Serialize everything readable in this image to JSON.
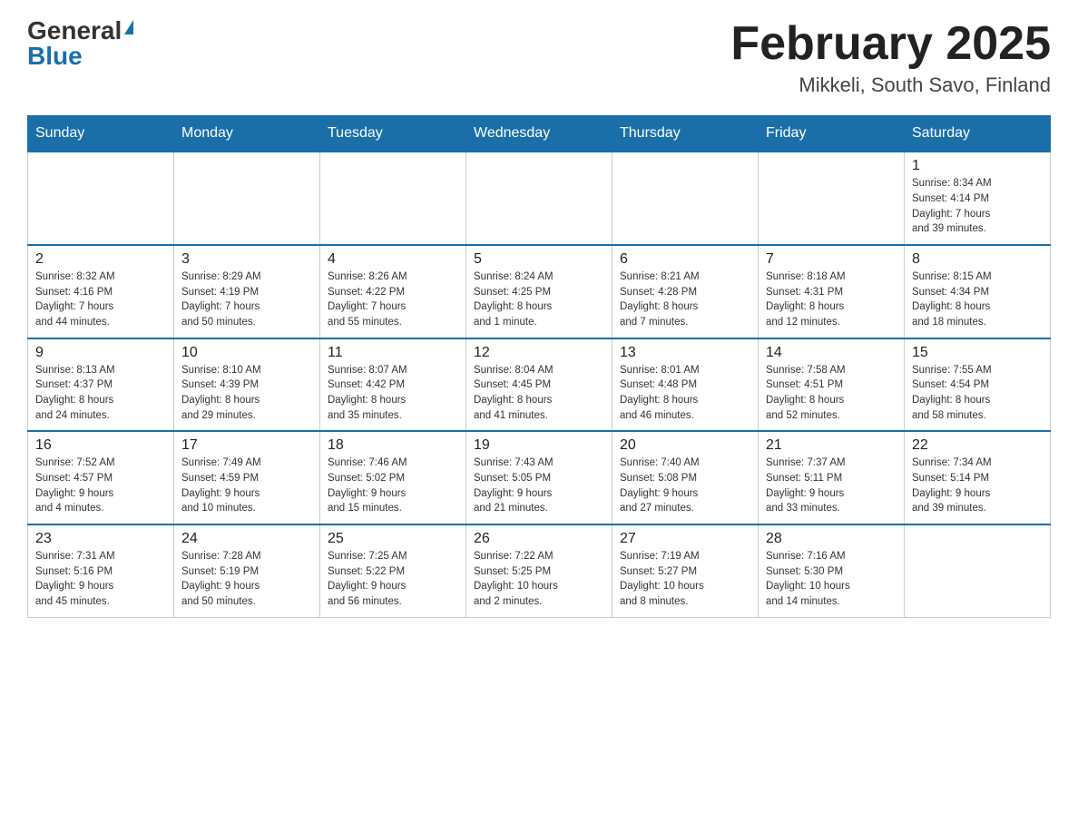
{
  "header": {
    "logo_general": "General",
    "logo_blue": "Blue",
    "title": "February 2025",
    "subtitle": "Mikkeli, South Savo, Finland"
  },
  "weekdays": [
    "Sunday",
    "Monday",
    "Tuesday",
    "Wednesday",
    "Thursday",
    "Friday",
    "Saturday"
  ],
  "weeks": [
    [
      {
        "day": "",
        "info": "",
        "empty": true
      },
      {
        "day": "",
        "info": "",
        "empty": true
      },
      {
        "day": "",
        "info": "",
        "empty": true
      },
      {
        "day": "",
        "info": "",
        "empty": true
      },
      {
        "day": "",
        "info": "",
        "empty": true
      },
      {
        "day": "",
        "info": "",
        "empty": true
      },
      {
        "day": "1",
        "info": "Sunrise: 8:34 AM\nSunset: 4:14 PM\nDaylight: 7 hours\nand 39 minutes.",
        "empty": false
      }
    ],
    [
      {
        "day": "2",
        "info": "Sunrise: 8:32 AM\nSunset: 4:16 PM\nDaylight: 7 hours\nand 44 minutes.",
        "empty": false
      },
      {
        "day": "3",
        "info": "Sunrise: 8:29 AM\nSunset: 4:19 PM\nDaylight: 7 hours\nand 50 minutes.",
        "empty": false
      },
      {
        "day": "4",
        "info": "Sunrise: 8:26 AM\nSunset: 4:22 PM\nDaylight: 7 hours\nand 55 minutes.",
        "empty": false
      },
      {
        "day": "5",
        "info": "Sunrise: 8:24 AM\nSunset: 4:25 PM\nDaylight: 8 hours\nand 1 minute.",
        "empty": false
      },
      {
        "day": "6",
        "info": "Sunrise: 8:21 AM\nSunset: 4:28 PM\nDaylight: 8 hours\nand 7 minutes.",
        "empty": false
      },
      {
        "day": "7",
        "info": "Sunrise: 8:18 AM\nSunset: 4:31 PM\nDaylight: 8 hours\nand 12 minutes.",
        "empty": false
      },
      {
        "day": "8",
        "info": "Sunrise: 8:15 AM\nSunset: 4:34 PM\nDaylight: 8 hours\nand 18 minutes.",
        "empty": false
      }
    ],
    [
      {
        "day": "9",
        "info": "Sunrise: 8:13 AM\nSunset: 4:37 PM\nDaylight: 8 hours\nand 24 minutes.",
        "empty": false
      },
      {
        "day": "10",
        "info": "Sunrise: 8:10 AM\nSunset: 4:39 PM\nDaylight: 8 hours\nand 29 minutes.",
        "empty": false
      },
      {
        "day": "11",
        "info": "Sunrise: 8:07 AM\nSunset: 4:42 PM\nDaylight: 8 hours\nand 35 minutes.",
        "empty": false
      },
      {
        "day": "12",
        "info": "Sunrise: 8:04 AM\nSunset: 4:45 PM\nDaylight: 8 hours\nand 41 minutes.",
        "empty": false
      },
      {
        "day": "13",
        "info": "Sunrise: 8:01 AM\nSunset: 4:48 PM\nDaylight: 8 hours\nand 46 minutes.",
        "empty": false
      },
      {
        "day": "14",
        "info": "Sunrise: 7:58 AM\nSunset: 4:51 PM\nDaylight: 8 hours\nand 52 minutes.",
        "empty": false
      },
      {
        "day": "15",
        "info": "Sunrise: 7:55 AM\nSunset: 4:54 PM\nDaylight: 8 hours\nand 58 minutes.",
        "empty": false
      }
    ],
    [
      {
        "day": "16",
        "info": "Sunrise: 7:52 AM\nSunset: 4:57 PM\nDaylight: 9 hours\nand 4 minutes.",
        "empty": false
      },
      {
        "day": "17",
        "info": "Sunrise: 7:49 AM\nSunset: 4:59 PM\nDaylight: 9 hours\nand 10 minutes.",
        "empty": false
      },
      {
        "day": "18",
        "info": "Sunrise: 7:46 AM\nSunset: 5:02 PM\nDaylight: 9 hours\nand 15 minutes.",
        "empty": false
      },
      {
        "day": "19",
        "info": "Sunrise: 7:43 AM\nSunset: 5:05 PM\nDaylight: 9 hours\nand 21 minutes.",
        "empty": false
      },
      {
        "day": "20",
        "info": "Sunrise: 7:40 AM\nSunset: 5:08 PM\nDaylight: 9 hours\nand 27 minutes.",
        "empty": false
      },
      {
        "day": "21",
        "info": "Sunrise: 7:37 AM\nSunset: 5:11 PM\nDaylight: 9 hours\nand 33 minutes.",
        "empty": false
      },
      {
        "day": "22",
        "info": "Sunrise: 7:34 AM\nSunset: 5:14 PM\nDaylight: 9 hours\nand 39 minutes.",
        "empty": false
      }
    ],
    [
      {
        "day": "23",
        "info": "Sunrise: 7:31 AM\nSunset: 5:16 PM\nDaylight: 9 hours\nand 45 minutes.",
        "empty": false
      },
      {
        "day": "24",
        "info": "Sunrise: 7:28 AM\nSunset: 5:19 PM\nDaylight: 9 hours\nand 50 minutes.",
        "empty": false
      },
      {
        "day": "25",
        "info": "Sunrise: 7:25 AM\nSunset: 5:22 PM\nDaylight: 9 hours\nand 56 minutes.",
        "empty": false
      },
      {
        "day": "26",
        "info": "Sunrise: 7:22 AM\nSunset: 5:25 PM\nDaylight: 10 hours\nand 2 minutes.",
        "empty": false
      },
      {
        "day": "27",
        "info": "Sunrise: 7:19 AM\nSunset: 5:27 PM\nDaylight: 10 hours\nand 8 minutes.",
        "empty": false
      },
      {
        "day": "28",
        "info": "Sunrise: 7:16 AM\nSunset: 5:30 PM\nDaylight: 10 hours\nand 14 minutes.",
        "empty": false
      },
      {
        "day": "",
        "info": "",
        "empty": true
      }
    ]
  ]
}
